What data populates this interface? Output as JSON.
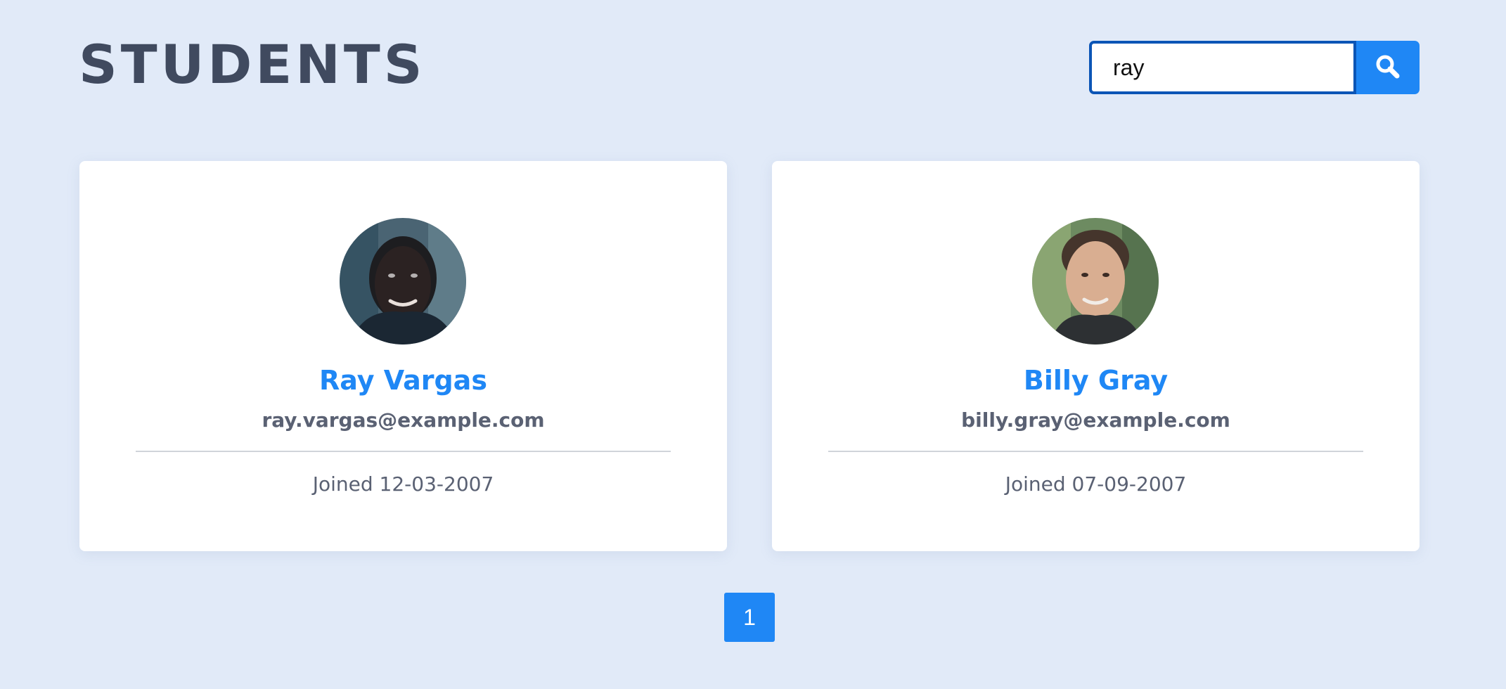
{
  "header": {
    "title": "STUDENTS"
  },
  "search": {
    "value": "ray",
    "button_icon": "search-icon"
  },
  "students": [
    {
      "name": "Ray Vargas",
      "email": "ray.vargas@example.com",
      "joined": "Joined 12-03-2007",
      "avatar": "avatar-photo"
    },
    {
      "name": "Billy Gray",
      "email": "billy.gray@example.com",
      "joined": "Joined 07-09-2007",
      "avatar": "avatar-photo"
    }
  ],
  "pagination": {
    "pages": [
      "1"
    ],
    "current": "1"
  },
  "colors": {
    "background": "#e1eaf8",
    "accent": "#1f87f5",
    "title": "#404a5f",
    "text": "#5a6173",
    "input_border": "#0b55b6"
  }
}
